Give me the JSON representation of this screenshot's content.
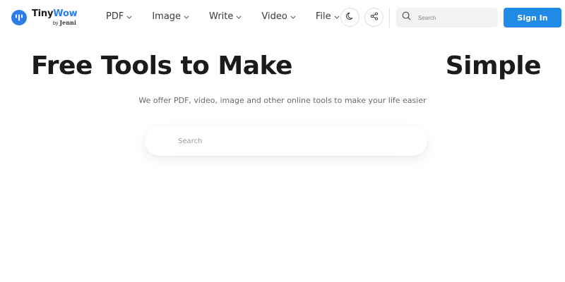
{
  "header": {
    "logo": {
      "name_main": "Tiny",
      "name_accent": "Wow",
      "by_prefix": "by",
      "by_name": "Jenni",
      "brand_color": "#2b7de9"
    },
    "nav": [
      {
        "label": "PDF",
        "icon": "chevron-down-icon"
      },
      {
        "label": "Image",
        "icon": "chevron-down-icon"
      },
      {
        "label": "Write",
        "icon": "chevron-down-icon"
      },
      {
        "label": "Video",
        "icon": "chevron-down-icon"
      },
      {
        "label": "File",
        "icon": "chevron-down-icon"
      }
    ],
    "theme_toggle_icon": "moon-icon",
    "share_icon": "share-icon",
    "search": {
      "icon": "search-icon",
      "placeholder": "Search",
      "value": ""
    },
    "signin_label": "Sign In",
    "signin_color": "#1f8be6"
  },
  "hero": {
    "title_left": "Free Tools to Make",
    "title_right": "Simple",
    "subtitle": "We offer PDF, video, image and other online tools to make your life easier",
    "search": {
      "placeholder": "Search",
      "value": ""
    }
  }
}
